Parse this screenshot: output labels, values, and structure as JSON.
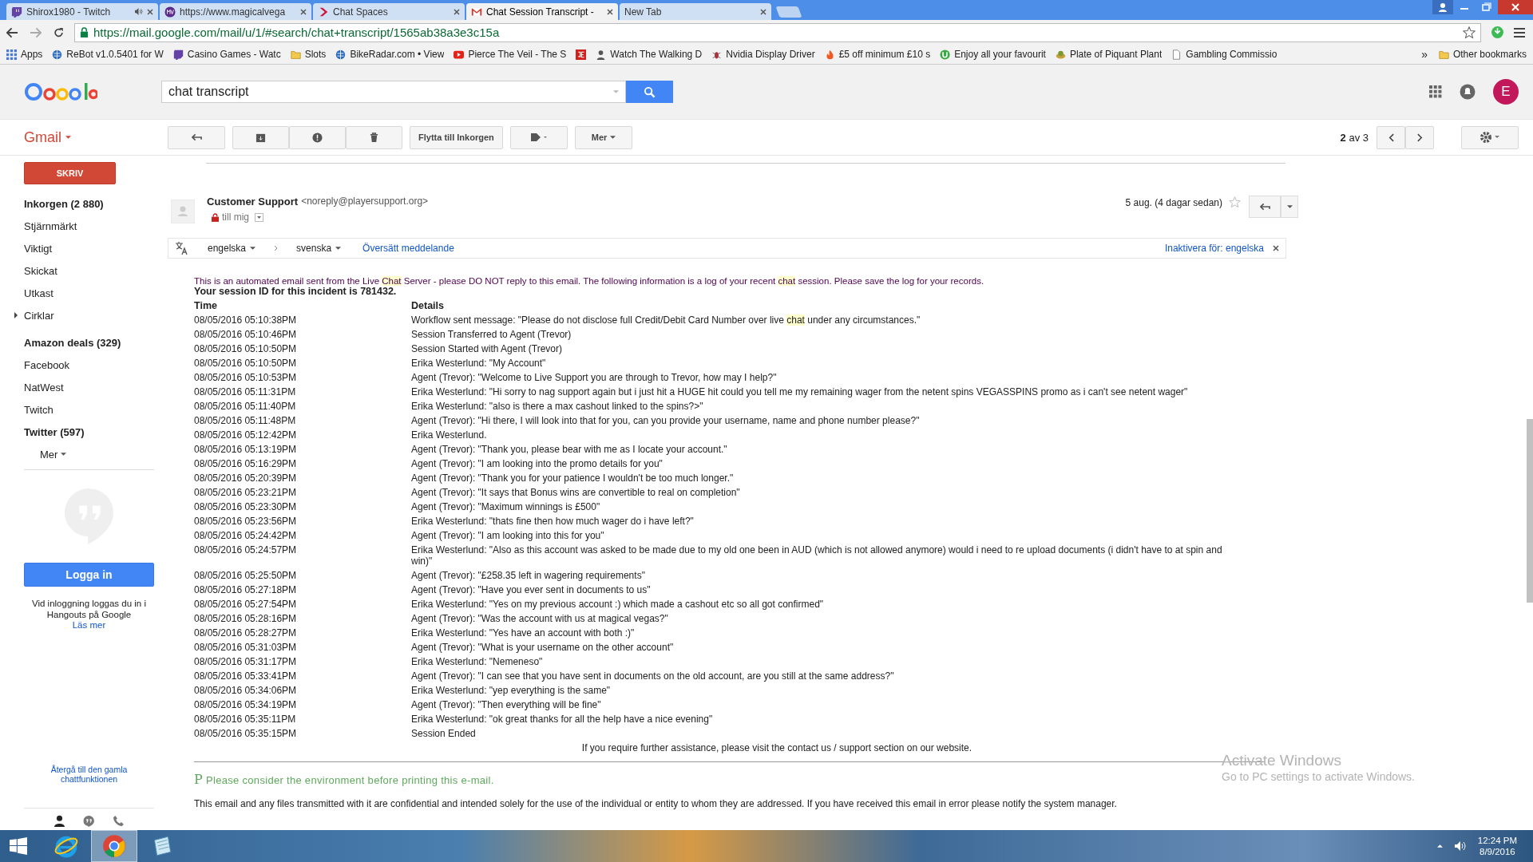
{
  "browser": {
    "tabs": [
      {
        "title": "Shirox1980 - Twitch",
        "selected": false
      },
      {
        "title": "https://www.magicalvega",
        "selected": false
      },
      {
        "title": "Chat Spaces",
        "selected": false
      },
      {
        "title": "Chat Session Transcript - ",
        "selected": true
      },
      {
        "title": "New Tab",
        "selected": false
      }
    ],
    "url": "https://mail.google.com/mail/u/1/#search/chat+transcript/1565ab38a3e3c15a",
    "bookmarks": [
      "Apps",
      "ReBot v1.0.5401 for W",
      "Casino Games - Watc",
      "Slots",
      "BikeRadar.com • View",
      "Pierce The Veil - The S",
      "Watch The Walking D",
      "Nvidia Display Driver",
      "£5 off minimum £10 s",
      "Enjoy all your favourit",
      "Plate of Piquant Plant",
      "Gambling Commissio"
    ],
    "bookmarks_overflow": "»",
    "other_bookmarks": "Other bookmarks"
  },
  "gmail": {
    "search": "chat transcript",
    "avatar": "E",
    "app_label": "Gmail",
    "move_button": "Flytta till Inkorgen",
    "more_button": "Mer",
    "pager_current": "2",
    "pager_rest": "av 3",
    "compose": "SKRIV",
    "nav": [
      {
        "label": "Inkorgen (2 880)",
        "bold": true
      },
      {
        "label": "Stjärnmärkt",
        "bold": false
      },
      {
        "label": "Viktigt",
        "bold": false
      },
      {
        "label": "Skickat",
        "bold": false
      },
      {
        "label": "Utkast",
        "bold": false
      },
      {
        "label": "Cirklar",
        "bold": false,
        "expandable": true
      },
      {
        "label": "Amazon deals (329)",
        "bold": true
      },
      {
        "label": "Facebook",
        "bold": false
      },
      {
        "label": "NatWest",
        "bold": false
      },
      {
        "label": "Twitch",
        "bold": false
      },
      {
        "label": "Twitter (597)",
        "bold": true
      }
    ],
    "nav_more": "Mer",
    "hangouts": {
      "button": "Logga in",
      "text": "Vid inloggning loggas du in i Hangouts på Google",
      "link": "Läs mer",
      "old_link": "Återgå till den gamla chattfunktionen"
    }
  },
  "message": {
    "sender": "Customer Support",
    "address": "<noreply@playersupport.org>",
    "to": "till mig",
    "date": "5 aug. (4 dagar sedan)",
    "translate": {
      "from": "engelska",
      "to": "svenska",
      "action": "Översätt meddelande",
      "disable": "Inaktivera för: engelska"
    },
    "intro": [
      {
        "text": "This is an automated email sent from the Live ",
        "highlight": false
      },
      {
        "text": "Chat",
        "highlight": true
      },
      {
        "text": " Server - please DO NOT reply to this email. The following information is a log of your recent ",
        "highlight": false
      },
      {
        "text": "chat",
        "highlight": true
      },
      {
        "text": " session. Please save the log for your records.",
        "highlight": false
      }
    ],
    "session": "Your session ID for this incident is 781432.",
    "columns": [
      "Time",
      "Details"
    ],
    "rows": [
      {
        "time": "08/05/2016 05:10:38PM",
        "details": [
          {
            "text": "Workflow sent message: \"Please do not disclose full Credit/Debit Card Number over live ",
            "highlight": false
          },
          {
            "text": "chat",
            "highlight": true
          },
          {
            "text": " under any circumstances.\"",
            "highlight": false
          }
        ]
      },
      {
        "time": "08/05/2016 05:10:46PM",
        "details": [
          {
            "text": "Session Transferred to Agent (Trevor)",
            "highlight": false
          }
        ]
      },
      {
        "time": "08/05/2016 05:10:50PM",
        "details": [
          {
            "text": "Session Started with Agent (Trevor)",
            "highlight": false
          }
        ]
      },
      {
        "time": "08/05/2016 05:10:50PM",
        "details": [
          {
            "text": "Erika Westerlund: \"My Account\"",
            "highlight": false
          }
        ]
      },
      {
        "time": "08/05/2016 05:10:53PM",
        "details": [
          {
            "text": "Agent (Trevor): \"Welcome to Live Support you are through to Trevor, how may I help?\"",
            "highlight": false
          }
        ]
      },
      {
        "time": "08/05/2016 05:11:31PM",
        "details": [
          {
            "text": "Erika Westerlund: \"Hi sorry to nag support again but i just hit a HUGE hit could you tell me my remaining wager from the netent spins VEGASSPINS promo as i can't see netent wager\"",
            "highlight": false
          }
        ]
      },
      {
        "time": "08/05/2016 05:11:40PM",
        "details": [
          {
            "text": "Erika Westerlund: \"also is there a max cashout linked to the spins?>\"",
            "highlight": false
          }
        ]
      },
      {
        "time": "08/05/2016 05:11:48PM",
        "details": [
          {
            "text": "Agent (Trevor): \"Hi there, I will look into that for you, can you provide your username, name and phone number please?\"",
            "highlight": false
          }
        ]
      },
      {
        "time": "08/05/2016 05:12:42PM",
        "details": [
          {
            "text": "Erika Westerlund.",
            "highlight": false
          }
        ]
      },
      {
        "time": "08/05/2016 05:13:19PM",
        "details": [
          {
            "text": "Agent (Trevor): \"Thank you, please bear with me as I locate your account.\"",
            "highlight": false
          }
        ]
      },
      {
        "time": "08/05/2016 05:16:29PM",
        "details": [
          {
            "text": "Agent (Trevor): \"I am looking into the promo details for you\"",
            "highlight": false
          }
        ]
      },
      {
        "time": "08/05/2016 05:20:39PM",
        "details": [
          {
            "text": "Agent (Trevor): \"Thank you for your patience I wouldn't be too much longer.\"",
            "highlight": false
          }
        ]
      },
      {
        "time": "08/05/2016 05:23:21PM",
        "details": [
          {
            "text": "Agent (Trevor): \"It says that Bonus wins are convertible to real on completion\"",
            "highlight": false
          }
        ]
      },
      {
        "time": "08/05/2016 05:23:30PM",
        "details": [
          {
            "text": "Agent (Trevor): \"Maximum winnings is £500\"",
            "highlight": false
          }
        ]
      },
      {
        "time": "08/05/2016 05:23:56PM",
        "details": [
          {
            "text": "Erika Westerlund: \"thats fine then how much wager do i have left?\"",
            "highlight": false
          }
        ]
      },
      {
        "time": "08/05/2016 05:24:42PM",
        "details": [
          {
            "text": "Agent (Trevor): \"I am looking into this for you\"",
            "highlight": false
          }
        ]
      },
      {
        "time": "08/05/2016 05:24:57PM",
        "details": [
          {
            "text": "Erika Westerlund: \"Also as this account was asked to be made due to my old one been in AUD (which is not allowed anymore) would i need to re upload documents (i didn't have to at spin and win)\"",
            "highlight": false
          }
        ]
      },
      {
        "time": "08/05/2016 05:25:50PM",
        "details": [
          {
            "text": "Agent (Trevor): \"£258.35 left in wagering requirements\"",
            "highlight": false
          }
        ]
      },
      {
        "time": "08/05/2016 05:27:18PM",
        "details": [
          {
            "text": "Agent (Trevor): \"Have you ever sent in documents to us\"",
            "highlight": false
          }
        ]
      },
      {
        "time": "08/05/2016 05:27:54PM",
        "details": [
          {
            "text": "Erika Westerlund: \"Yes on my previous account :) which made a cashout etc so all got confirmed\"",
            "highlight": false
          }
        ]
      },
      {
        "time": "08/05/2016 05:28:16PM",
        "details": [
          {
            "text": "Agent (Trevor): \"Was the account with us at magical vegas?\"",
            "highlight": false
          }
        ]
      },
      {
        "time": "08/05/2016 05:28:27PM",
        "details": [
          {
            "text": "Erika Westerlund: \"Yes have an account with both :)\"",
            "highlight": false
          }
        ]
      },
      {
        "time": "08/05/2016 05:31:03PM",
        "details": [
          {
            "text": "Agent (Trevor): \"What is your username on the other account\"",
            "highlight": false
          }
        ]
      },
      {
        "time": "08/05/2016 05:31:17PM",
        "details": [
          {
            "text": "Erika Westerlund: \"Nemeneso\"",
            "highlight": false
          }
        ]
      },
      {
        "time": "08/05/2016 05:33:41PM",
        "details": [
          {
            "text": "Agent (Trevor): \"I can see that you have sent in documents on the old account, are you still at the same address?\"",
            "highlight": false
          }
        ]
      },
      {
        "time": "08/05/2016 05:34:06PM",
        "details": [
          {
            "text": "Erika Westerlund: \"yep everything is the same\"",
            "highlight": false
          }
        ]
      },
      {
        "time": "08/05/2016 05:34:19PM",
        "details": [
          {
            "text": "Agent (Trevor): \"Then everything will be fine\"",
            "highlight": false
          }
        ]
      },
      {
        "time": "08/05/2016 05:35:11PM",
        "details": [
          {
            "text": "Erika Westerlund: \"ok great thanks for all the help have a nice evening\"",
            "highlight": false
          }
        ]
      },
      {
        "time": "08/05/2016 05:35:15PM",
        "details": [
          {
            "text": "Session Ended",
            "highlight": false
          }
        ]
      }
    ],
    "assistance": "If you require further assistance, please visit the contact us / support section on our website.",
    "eco_mark": "P",
    "eco": "Please consider the environment before printing this e-mail.",
    "disclaimer": "This email and any files transmitted with it are confidential and intended solely for the use of the individual or entity to whom they are addressed. If you have received this email in error please notify the system manager."
  },
  "os": {
    "activate_title": "Activate Windows",
    "activate_text": "Go to PC settings to activate Windows.",
    "taskbar": [
      {
        "selected": false
      },
      {
        "selected": true
      },
      {
        "selected": false
      }
    ],
    "time": "12:24 PM",
    "date": "8/9/2016"
  }
}
